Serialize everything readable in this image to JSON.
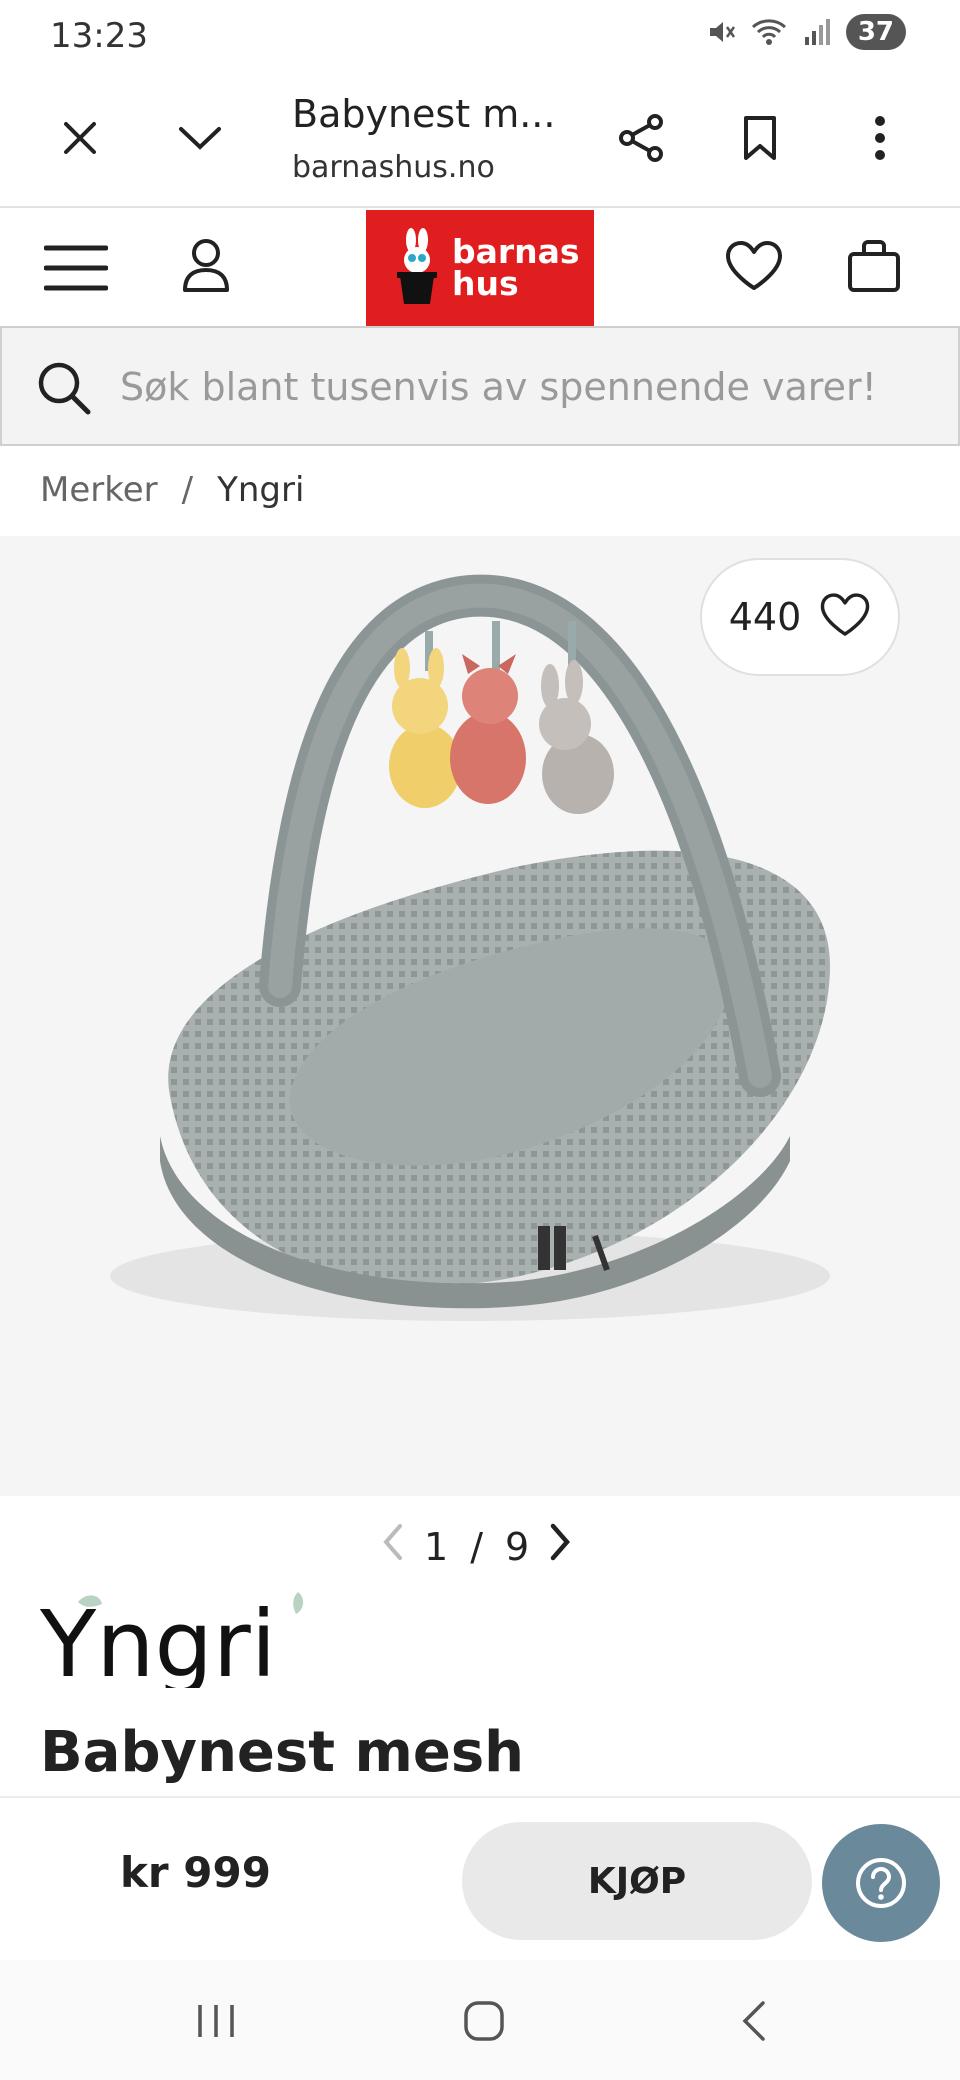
{
  "status_bar": {
    "time": "13:23",
    "battery": "37",
    "icons": [
      "mute-icon",
      "wifi-icon",
      "signal-icon",
      "battery-icon"
    ]
  },
  "browser": {
    "title": "Babynest m...",
    "url": "barnashus.no",
    "icons": [
      "close-icon",
      "chevron-down-icon",
      "share-icon",
      "bookmark-icon",
      "more-vert-icon"
    ]
  },
  "site_header": {
    "logo_line1": "barnas",
    "logo_line2": "hus",
    "brand_color": "#e01d1f",
    "icons": [
      "menu-icon",
      "user-icon",
      "heart-icon",
      "bag-icon"
    ]
  },
  "search": {
    "placeholder": "Søk blant tusenvis av spennende varer!"
  },
  "breadcrumb": {
    "items": [
      "Merker",
      "Yngri"
    ],
    "separator": "/"
  },
  "product": {
    "favorites": "440",
    "image_index": "1",
    "image_total": "9",
    "pager_sep": "/",
    "brand": "Yngri",
    "title": "Babynest mesh"
  },
  "buy_bar": {
    "price": "kr 999",
    "buy_label": "KJØP",
    "help_color": "#6a8a9b"
  },
  "nav_bar": {
    "icons": [
      "recents-icon",
      "home-icon",
      "back-icon"
    ]
  }
}
